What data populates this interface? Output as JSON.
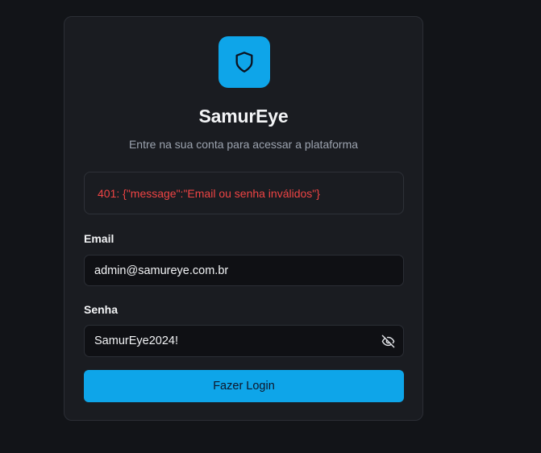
{
  "app": {
    "title": "SamurEye",
    "subtitle": "Entre na sua conta para acessar a plataforma"
  },
  "error": {
    "message": "401: {\"message\":\"Email ou senha inválidos\"}"
  },
  "form": {
    "email": {
      "label": "Email",
      "value": "admin@samureye.com.br"
    },
    "password": {
      "label": "Senha",
      "value": "SamurEye2024!",
      "toggle_icon": "eye-off-icon"
    },
    "submit_label": "Fazer Login"
  },
  "icons": {
    "logo": "shield-icon"
  },
  "colors": {
    "accent": "#0ea5e9",
    "error": "#ef4444",
    "background": "#121418",
    "card": "#1a1c21"
  }
}
